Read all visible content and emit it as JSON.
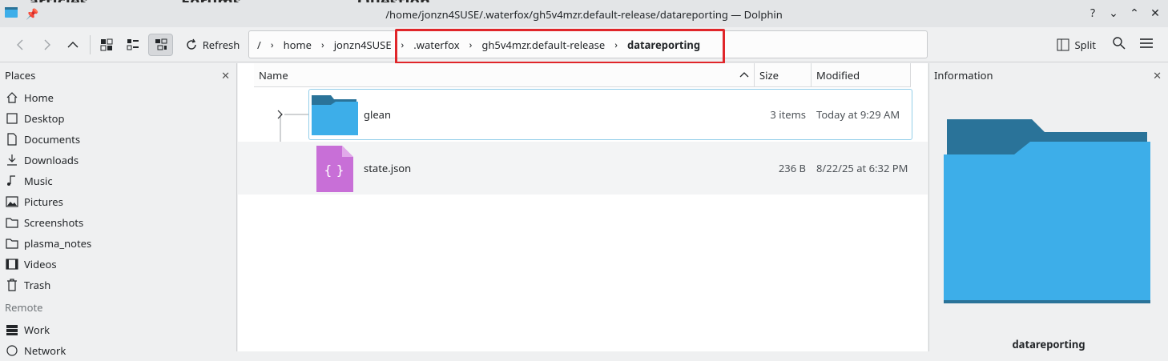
{
  "window": {
    "title": "/home/jonzn4SUSE/.waterfox/gh5v4mzr.default-release/datareporting — Dolphin",
    "background_partial_texts": [
      "articles",
      "Forums",
      "Question"
    ]
  },
  "toolbar": {
    "refresh_label": "Refresh",
    "split_label": "Split"
  },
  "breadcrumb": {
    "root": "/",
    "items": [
      "home",
      "jonzn4SUSE",
      ".waterfox",
      "gh5v4mzr.default-release",
      "datareporting"
    ]
  },
  "places": {
    "title": "Places",
    "items": [
      {
        "label": "Home",
        "icon": "home-icon"
      },
      {
        "label": "Desktop",
        "icon": "desktop-icon"
      },
      {
        "label": "Documents",
        "icon": "documents-icon"
      },
      {
        "label": "Downloads",
        "icon": "downloads-icon"
      },
      {
        "label": "Music",
        "icon": "music-icon"
      },
      {
        "label": "Pictures",
        "icon": "pictures-icon"
      },
      {
        "label": "Screenshots",
        "icon": "folder-icon"
      },
      {
        "label": "plasma_notes",
        "icon": "folder-icon"
      },
      {
        "label": "Videos",
        "icon": "videos-icon"
      },
      {
        "label": "Trash",
        "icon": "trash-icon"
      }
    ],
    "remote_label": "Remote",
    "remote_items": [
      {
        "label": "Work",
        "icon": "server-icon"
      },
      {
        "label": "Network",
        "icon": "network-icon"
      }
    ]
  },
  "columns": {
    "name": "Name",
    "size": "Size",
    "modified": "Modified"
  },
  "files": [
    {
      "name": "glean",
      "size": "3 items",
      "modified": "Today at 9:29 AM",
      "type": "folder"
    },
    {
      "name": "state.json",
      "size": "236 B",
      "modified": "8/22/25 at 6:32 PM",
      "type": "json"
    }
  ],
  "info_panel": {
    "title": "Information",
    "selected_name": "datareporting"
  },
  "colors": {
    "accent": "#3daee9",
    "folder_light": "#3daee9",
    "folder_dark": "#2a7399",
    "json_file": "#c86fd7",
    "highlight": "#e0262a"
  }
}
